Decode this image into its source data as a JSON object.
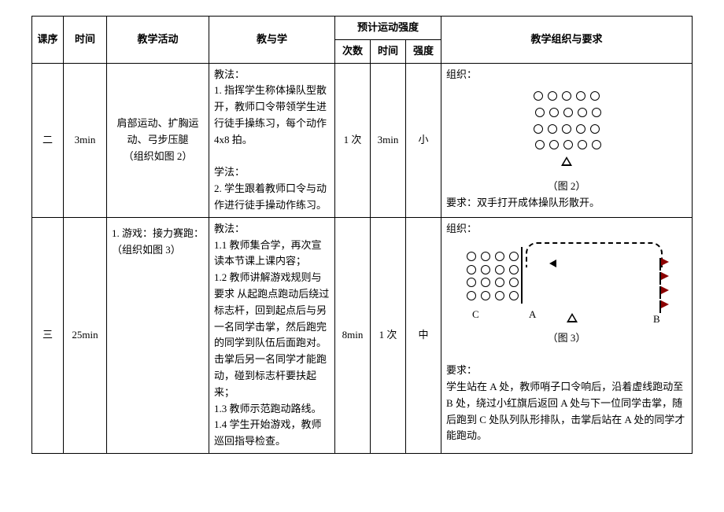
{
  "headers": {
    "seq": "课序",
    "time": "时间",
    "activity": "教学活动",
    "teach": "教与学",
    "predict": "预计运动强度",
    "count": "次数",
    "duration": "时间",
    "intensity": "强度",
    "org": "教学组织与要求"
  },
  "rows": [
    {
      "seq": "二",
      "time": "3min",
      "activity": "肩部运动、扩胸运动、弓步压腿\n（组织如图 2）",
      "teach": "教法：\n1. 指挥学生称体操队型散开，教师口令带领学生进行徒手操练习，每个动作 4x8 拍。\n\n学法：\n2. 学生跟着教师口令与动作进行徒手操动作练习。",
      "count": "1 次",
      "duration": "3min",
      "intensity": "小",
      "org_label": "组织：",
      "fig_caption": "（图 2）",
      "req": "要求：双手打开成体操队形散开。"
    },
    {
      "seq": "三",
      "time": "25min",
      "activity": "1.  游戏：接力赛跑：\n（组织如图 3）",
      "teach": "教法：\n1.1 教师集合学，再次宣读本节课上课内容；\n1.2 教师讲解游戏规则与要求  从起跑点跑动后绕过标志杆，回到起点后与另一名同学击掌，然后跑完的同学到队伍后面跑对。击掌后另一名同学才能跑动，碰到标志杆要扶起来；\n1.3 教师示范跑动路线。\n1.4 学生开始游戏，教师巡回指导检查。",
      "count": "8min",
      "duration": "1 次",
      "intensity": "中",
      "org_label": "组织：",
      "fig_caption": "（图 3）",
      "labels": {
        "A": "A",
        "B": "B",
        "C": "C"
      },
      "req_label": "要求：",
      "req": "学生站在 A 处，教师哨子口令响后，沿着虚线跑动至 B 处，绕过小红旗后返回 A 处与下一位同学击掌，随后跑到 C 处队列队形排队，击掌后站在 A 处的同学才能跑动。"
    }
  ]
}
